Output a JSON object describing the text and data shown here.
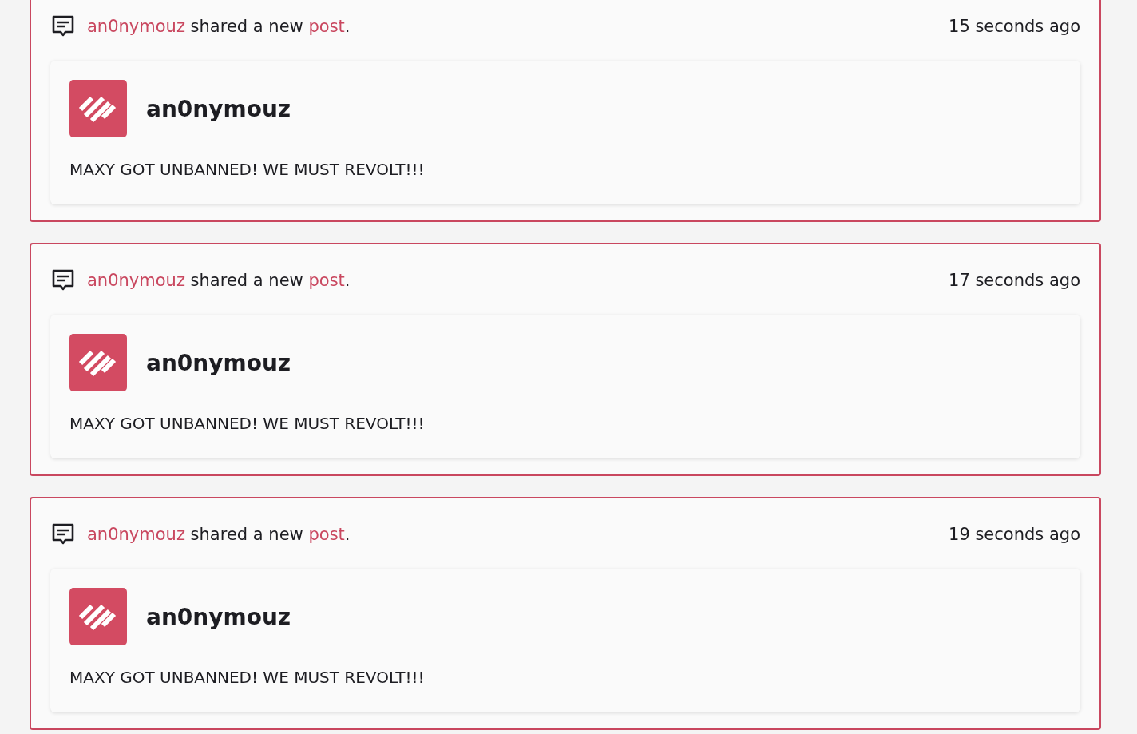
{
  "feed": [
    {
      "actor": "an0nymouz",
      "action": " shared a new ",
      "object": "post",
      "end": ".",
      "time": "15 seconds ago",
      "post": {
        "author": "an0nymouz",
        "text": "MAXY GOT UNBANNED! WE MUST REVOLT!!!"
      }
    },
    {
      "actor": "an0nymouz",
      "action": " shared a new ",
      "object": "post",
      "end": ".",
      "time": "17 seconds ago",
      "post": {
        "author": "an0nymouz",
        "text": "MAXY GOT UNBANNED! WE MUST REVOLT!!!"
      }
    },
    {
      "actor": "an0nymouz",
      "action": " shared a new ",
      "object": "post",
      "end": ".",
      "time": "19 seconds ago",
      "post": {
        "author": "an0nymouz",
        "text": "MAXY GOT UNBANNED! WE MUST REVOLT!!!"
      }
    }
  ]
}
